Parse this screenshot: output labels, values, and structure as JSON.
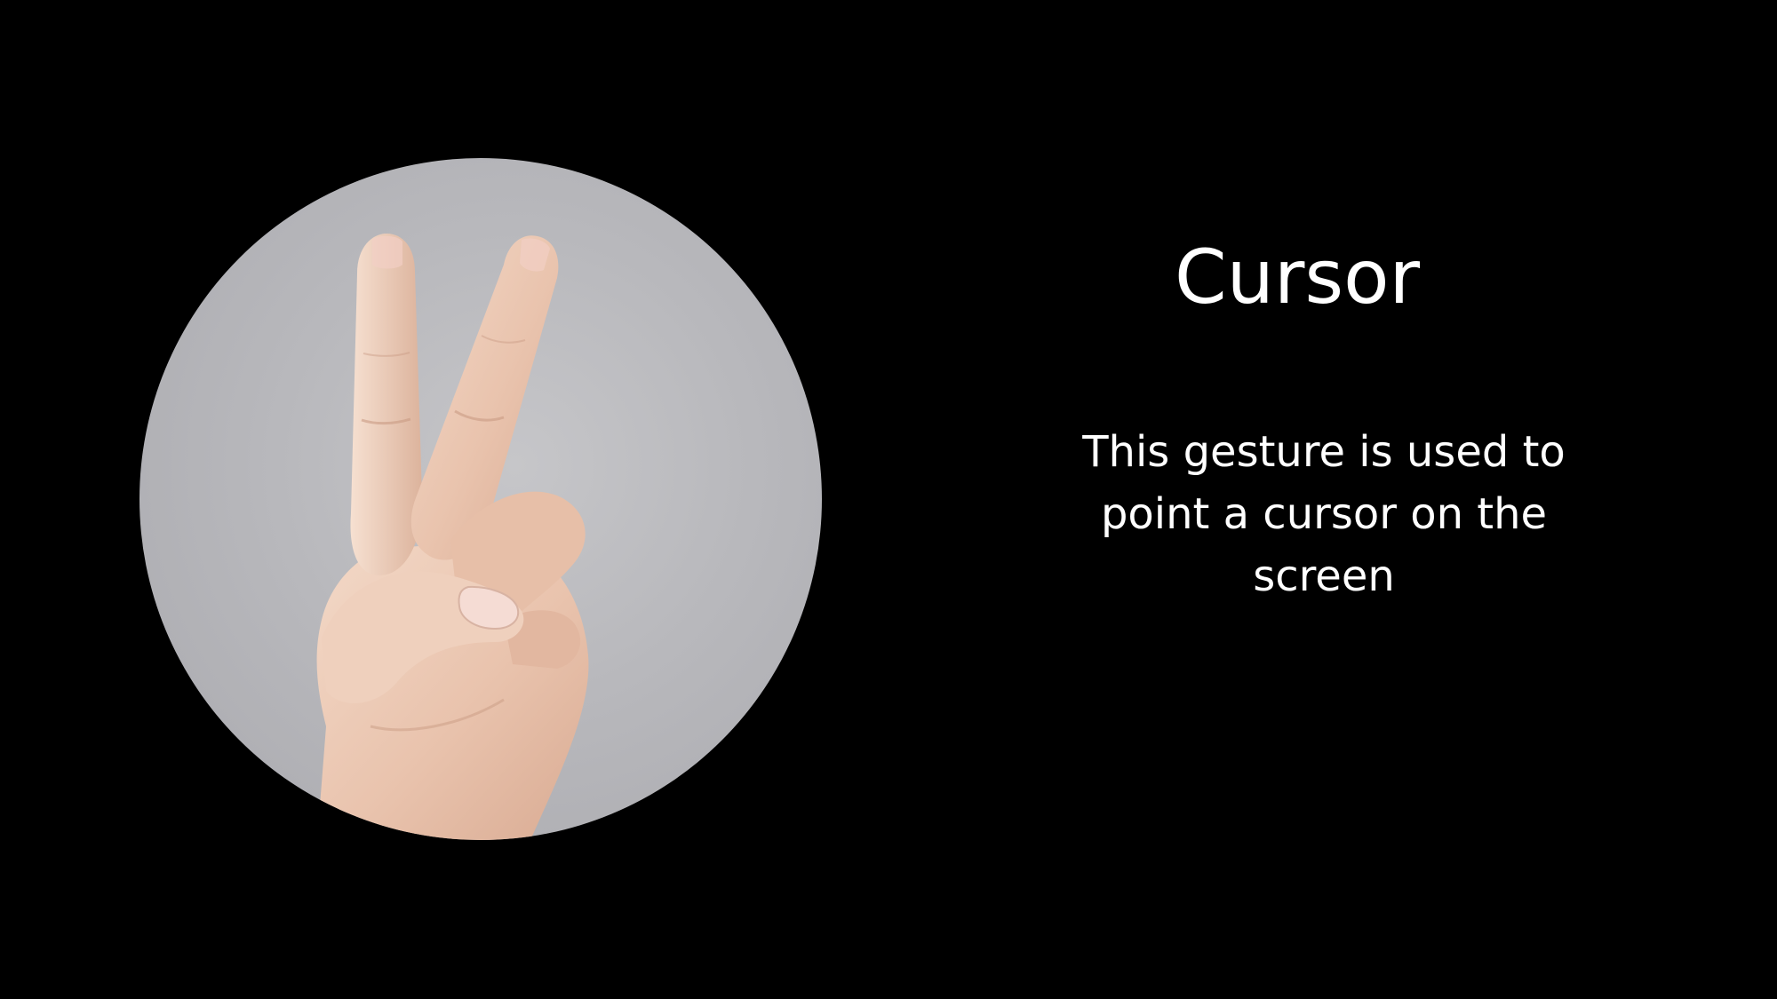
{
  "slide": {
    "title": "Cursor",
    "description": "This gesture is used to point a cursor on the screen",
    "background_color": "#000000",
    "text_color": "#ffffff"
  },
  "image": {
    "subject": "hand-v-gesture",
    "shape": "circle"
  }
}
